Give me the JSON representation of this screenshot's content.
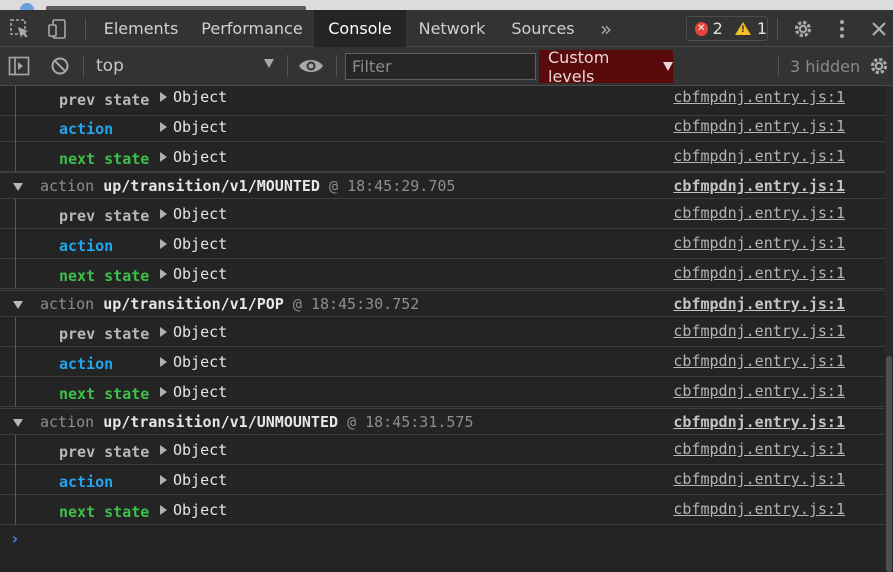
{
  "tabs": [
    "Elements",
    "Performance",
    "Console",
    "Network",
    "Sources"
  ],
  "badges": {
    "errors": "2",
    "warnings": "1"
  },
  "toolbar": {
    "context": "top",
    "filter_placeholder": "Filter",
    "levels": "Custom levels",
    "hidden": "3 hidden"
  },
  "labels": {
    "prev_state": "prev state",
    "action": "action",
    "next_state": "next state",
    "object": "Object"
  },
  "source": "cbfmpdnj.entry.js:1",
  "groups": [
    {
      "word": "action",
      "type": "up/transition/v1/MOUNTED",
      "at": "@",
      "time": "18:45:29.705"
    },
    {
      "word": "action",
      "type": "up/transition/v1/POP",
      "at": "@",
      "time": "18:45:30.752"
    },
    {
      "word": "action",
      "type": "up/transition/v1/UNMOUNTED",
      "at": "@",
      "time": "18:45:31.575"
    }
  ],
  "prompt": "›",
  "colors": {
    "accent_blue": "#1fa6ee",
    "accent_green": "#3fbf4a",
    "error_red": "#e5443b",
    "warning_yellow": "#f3c025",
    "levels_bg": "#5a0a0a"
  }
}
